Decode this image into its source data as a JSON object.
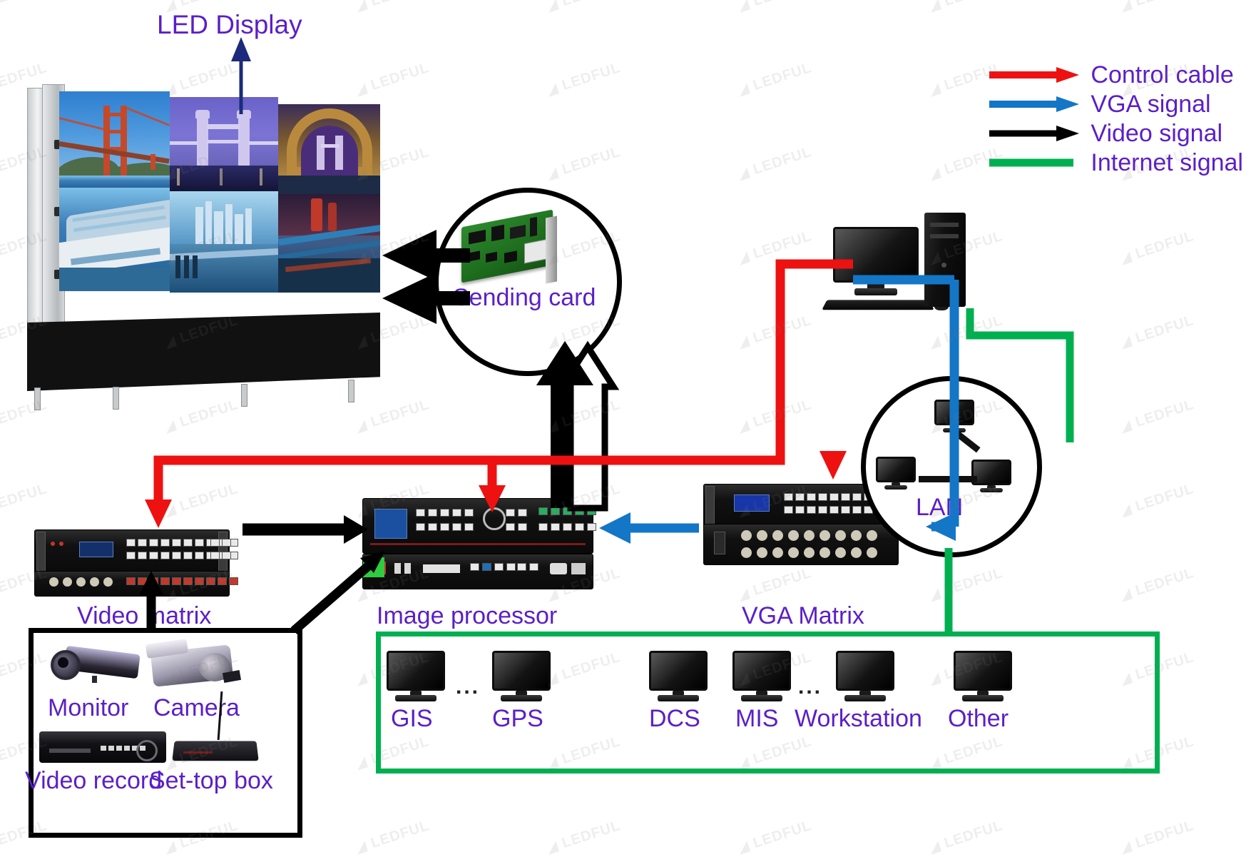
{
  "diagram": {
    "title_label": "LED Display",
    "watermark_text": "LEDFUL"
  },
  "legend": {
    "items": [
      {
        "label": "Control cable",
        "color": "#ee1111",
        "arrow": true
      },
      {
        "label": "VGA signal",
        "color": "#1476c6",
        "arrow": true
      },
      {
        "label": "Video signal",
        "color": "#000000",
        "arrow": true
      },
      {
        "label": "Internet signal",
        "color": "#00b050",
        "arrow": false
      }
    ]
  },
  "nodes": {
    "led_display": "LED Display",
    "sending_card": "Sending card",
    "video_matrix": "Video matrix",
    "image_processor": "Image processor",
    "vga_matrix": "VGA Matrix",
    "lan": "LAN"
  },
  "sources": {
    "items": [
      {
        "label": "Monitor",
        "icon": "cctv-camera-icon"
      },
      {
        "label": "Camera",
        "icon": "camcorder-icon"
      },
      {
        "label": "Video record",
        "icon": "dvr-icon"
      },
      {
        "label": "Set-top box",
        "icon": "set-top-box-icon"
      }
    ]
  },
  "network": {
    "ellipsis": "...",
    "terminals": [
      {
        "label": "GIS"
      },
      {
        "label": "GPS"
      },
      {
        "label": "DCS"
      },
      {
        "label": "MIS"
      },
      {
        "label": "Workstation"
      },
      {
        "label": "Other"
      }
    ]
  },
  "colors": {
    "control_cable": "#ee1111",
    "vga_signal": "#1476c6",
    "video_signal": "#000000",
    "internet_signal": "#00b050",
    "label_text": "#5B1FC8"
  }
}
